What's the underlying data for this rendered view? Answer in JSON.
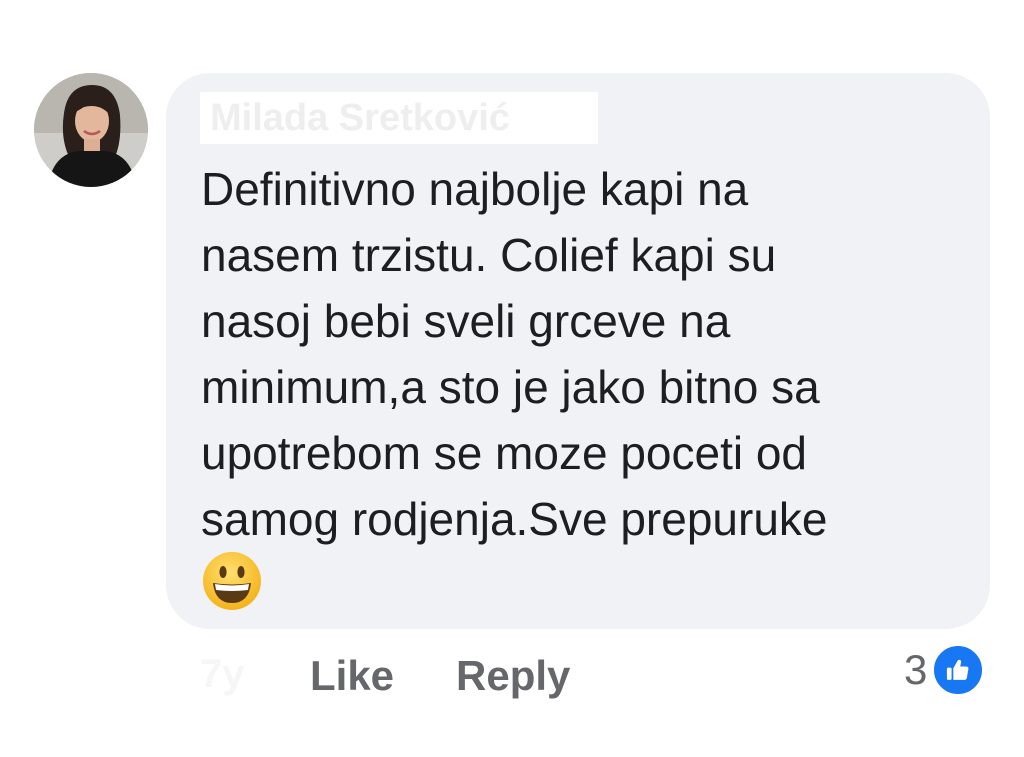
{
  "comment": {
    "author_name": "Milada Sretković",
    "text": "Definitivno najbolje kapi na\nnasem trzistu. Colief kapi su\nnasoj bebi sveli grceve na\nminimum,a sto je jako bitno sa\nupotrebom se moze poceti od\nsamog rodjenja.Sve prepuruke",
    "emoji": "grinning-face-emoji"
  },
  "actions": {
    "time": "7y",
    "like_label": "Like",
    "reply_label": "Reply"
  },
  "reactions": {
    "count": "3",
    "icon": "thumbs-up-icon",
    "badge_color": "#1877f2"
  },
  "colors": {
    "bubble": "#f0f2f5",
    "text": "#1c1e21",
    "secondary_text": "#65676b"
  }
}
